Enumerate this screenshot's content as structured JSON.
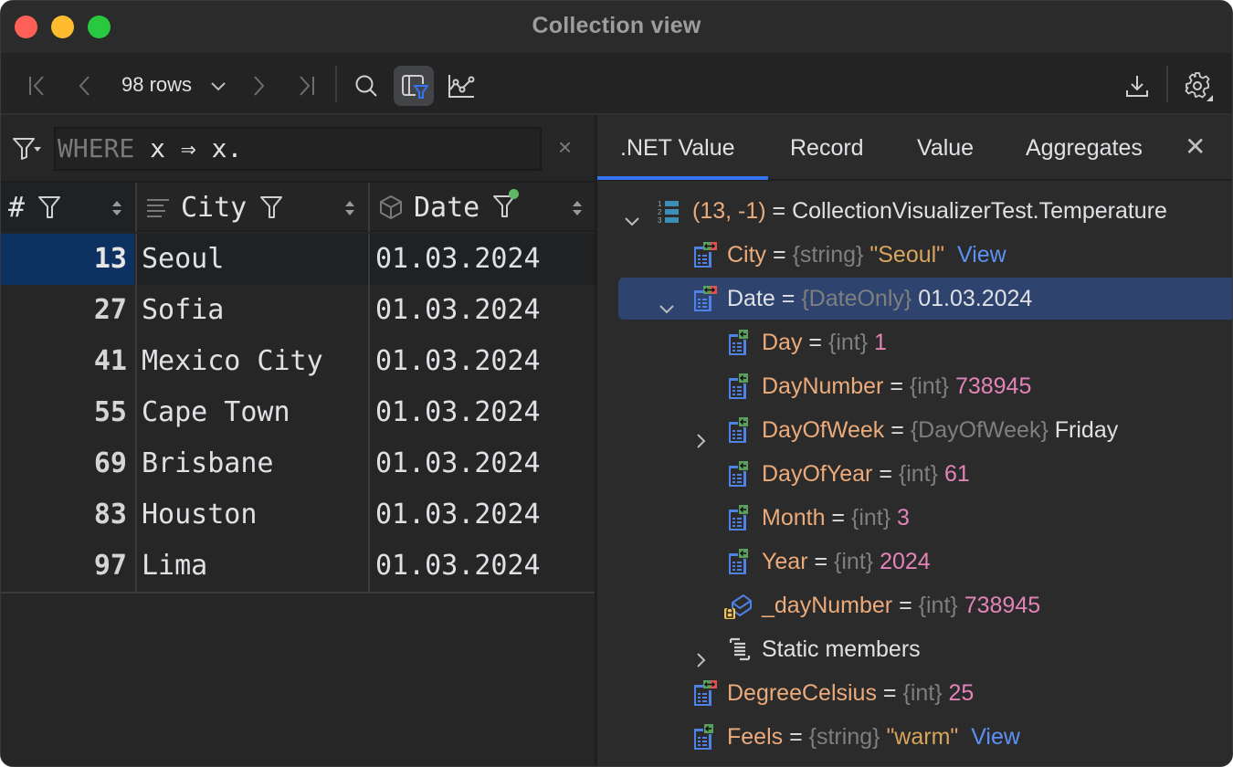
{
  "window": {
    "title": "Collection view"
  },
  "toolbar": {
    "rows_label": "98 rows",
    "icons": [
      "first-page-icon",
      "prev-page-icon",
      "chevron-down-icon",
      "next-page-icon",
      "last-page-icon",
      "search-icon",
      "filter-columns-icon",
      "chart-icon",
      "download-icon",
      "settings-icon"
    ]
  },
  "filter": {
    "keyword": "WHERE",
    "expression": " x ⇒ x.",
    "clear_label": "×"
  },
  "grid": {
    "columns": [
      {
        "label": "#",
        "icon": "filter-icon"
      },
      {
        "label": "City",
        "icon": "text-type-icon"
      },
      {
        "label": "Date",
        "icon": "struct-type-icon",
        "filtered": true
      }
    ],
    "rows": [
      {
        "num": "13",
        "city": "Seoul",
        "date": "01.03.2024",
        "selected": true
      },
      {
        "num": "27",
        "city": "Sofia",
        "date": "01.03.2024"
      },
      {
        "num": "41",
        "city": "Mexico City",
        "date": "01.03.2024"
      },
      {
        "num": "55",
        "city": "Cape Town",
        "date": "01.03.2024"
      },
      {
        "num": "69",
        "city": "Brisbane",
        "date": "01.03.2024"
      },
      {
        "num": "83",
        "city": "Houston",
        "date": "01.03.2024"
      },
      {
        "num": "97",
        "city": "Lima",
        "date": "01.03.2024"
      }
    ]
  },
  "details": {
    "tabs": [
      ".NET Value",
      "Record",
      "Value",
      "Aggregates"
    ],
    "active_tab": ".NET Value",
    "close_label": "✕",
    "tree": [
      {
        "key": "(13, -1)",
        "eq": " = ",
        "type": "",
        "value": "CollectionVisualizerTest.Temperature",
        "value_kind": "plain",
        "expanded": true
      },
      {
        "key": "City",
        "eq": " = ",
        "type": "{string}",
        "value": "\"Seoul\"",
        "value_kind": "str",
        "link": "View"
      },
      {
        "key": "Date",
        "eq": " = ",
        "type": "{DateOnly}",
        "value": "01.03.2024",
        "value_kind": "plain",
        "expanded": true,
        "selected": true
      },
      {
        "key": "Day",
        "eq": " = ",
        "type": "{int}",
        "value": "1",
        "value_kind": "num"
      },
      {
        "key": "DayNumber",
        "eq": " = ",
        "type": "{int}",
        "value": "738945",
        "value_kind": "num"
      },
      {
        "key": "DayOfWeek",
        "eq": " = ",
        "type": "{DayOfWeek}",
        "value": "Friday",
        "value_kind": "plain",
        "expandable": true
      },
      {
        "key": "DayOfYear",
        "eq": " = ",
        "type": "{int}",
        "value": "61",
        "value_kind": "num"
      },
      {
        "key": "Month",
        "eq": " = ",
        "type": "{int}",
        "value": "3",
        "value_kind": "num"
      },
      {
        "key": "Year",
        "eq": " = ",
        "type": "{int}",
        "value": "2024",
        "value_kind": "num"
      },
      {
        "key": "_dayNumber",
        "eq": " = ",
        "type": "{int}",
        "value": "738945",
        "value_kind": "num"
      },
      {
        "key": "Static members",
        "eq": "",
        "type": "",
        "value": "",
        "value_kind": "plain",
        "expandable": true
      },
      {
        "key": "DegreeCelsius",
        "eq": " = ",
        "type": "{int}",
        "value": "25",
        "value_kind": "num"
      },
      {
        "key": "Feels",
        "eq": " = ",
        "type": "{string}",
        "value": "\"warm\"",
        "value_kind": "str",
        "link": "View"
      }
    ]
  },
  "colors": {
    "accent": "#3574f0",
    "selection": "#2e436e",
    "row_selected_num": "#0d3160",
    "property_name": "#ecab7b",
    "string_value": "#d9a55d",
    "number_value": "#e384b8",
    "link": "#5b91f5",
    "filter_active_dot": "#5fb865"
  }
}
